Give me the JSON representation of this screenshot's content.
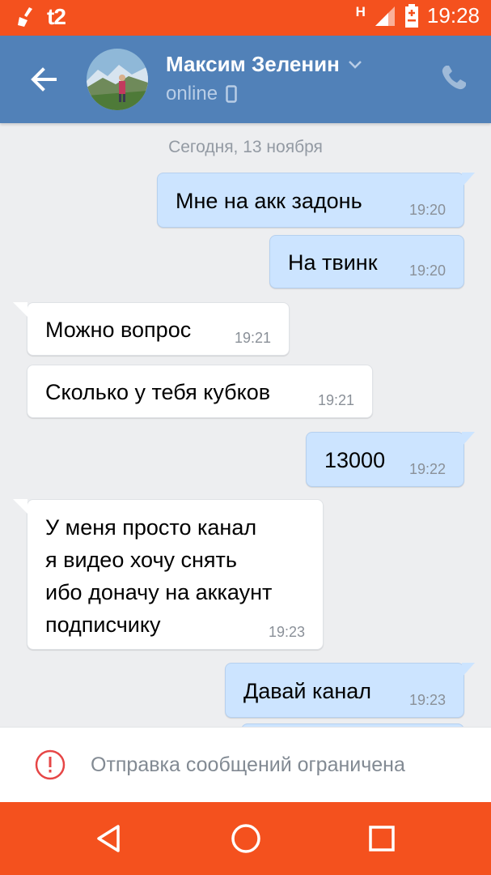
{
  "status_bar": {
    "carrier": "t2",
    "network": "H",
    "time": "19:28"
  },
  "header": {
    "contact_name": "Максим Зеленин",
    "status": "online"
  },
  "chat": {
    "date_label": "Сегодня, 13 ноября",
    "messages": [
      {
        "direction": "out",
        "lines": [
          "Мне на акк задонь"
        ],
        "time": "19:20"
      },
      {
        "direction": "out",
        "lines": [
          "На твинк"
        ],
        "time": "19:20"
      },
      {
        "direction": "in",
        "lines": [
          "Можно вопрос"
        ],
        "time": "19:21"
      },
      {
        "direction": "in",
        "lines": [
          "Сколько у тебя кубков"
        ],
        "time": "19:21"
      },
      {
        "direction": "out",
        "lines": [
          "13000"
        ],
        "time": "19:22"
      },
      {
        "direction": "in",
        "lines": [
          "У меня просто канал",
          "я видео хочу снять",
          "ибо доначу на аккаунт",
          "подписчику"
        ],
        "time": "19:23"
      },
      {
        "direction": "out",
        "lines": [
          "Давай канал"
        ],
        "time": "19:23"
      }
    ]
  },
  "notice": {
    "text": "Отправка сообщений ограничена",
    "icon": "alert-circle-icon"
  },
  "colors": {
    "status_bar": "#f4511e",
    "header": "#5181b8",
    "outgoing_bubble": "#cce4ff",
    "incoming_bubble": "#ffffff",
    "background": "#edeef0",
    "alert": "#e64646"
  }
}
